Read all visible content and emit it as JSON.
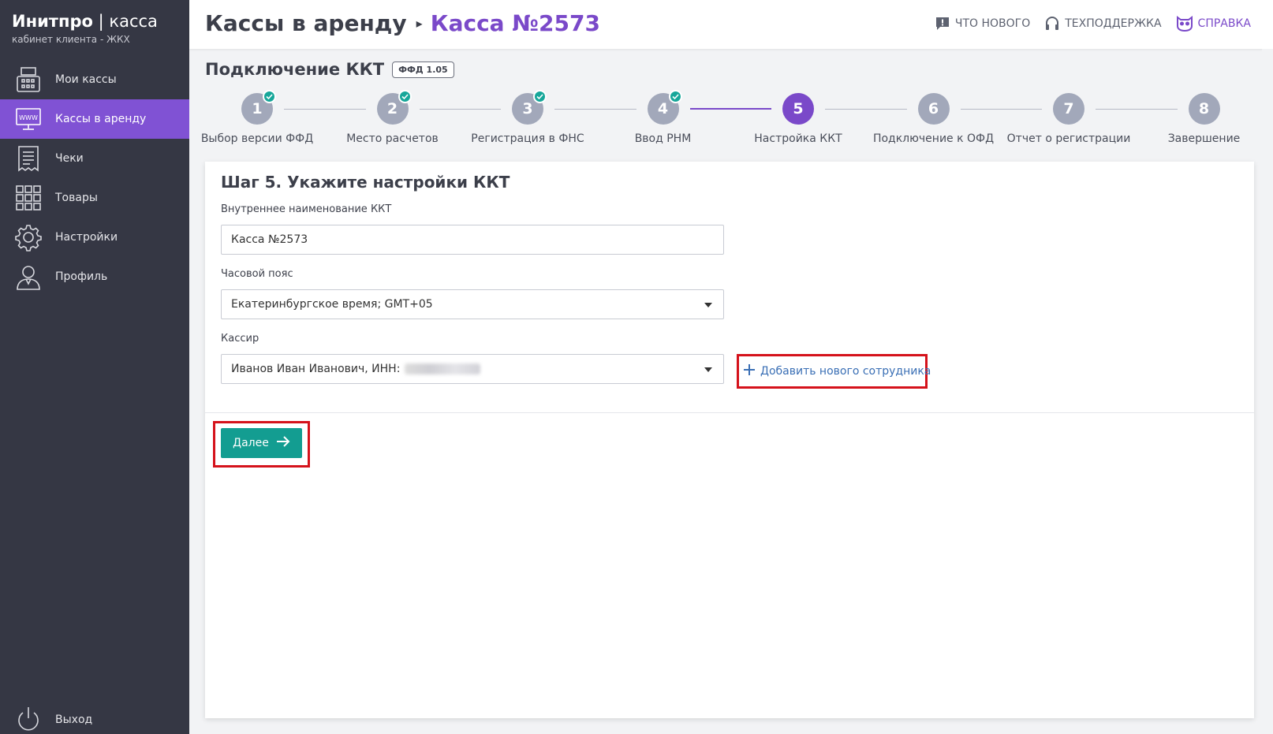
{
  "brand": {
    "name_bold": "Инитпро",
    "name_sep": "|",
    "name_light": "касса",
    "subtitle": "кабинет клиента - ЖКХ"
  },
  "sidebar": {
    "items": [
      {
        "label": "Мои кассы",
        "icon": "cash-register-icon",
        "active": false
      },
      {
        "label": "Кассы в аренду",
        "icon": "www-monitor-icon",
        "active": true
      },
      {
        "label": "Чеки",
        "icon": "receipt-icon",
        "active": false
      },
      {
        "label": "Товары",
        "icon": "grid-icon",
        "active": false
      },
      {
        "label": "Настройки",
        "icon": "gear-icon",
        "active": false
      },
      {
        "label": "Профиль",
        "icon": "user-icon",
        "active": false
      }
    ],
    "logout": {
      "label": "Выход",
      "icon": "power-icon"
    }
  },
  "header": {
    "breadcrumb_root": "Кассы в аренду",
    "breadcrumb_current": "Касса №2573",
    "links": {
      "news": "Что нового",
      "support": "Техподдержка",
      "help": "Справка"
    }
  },
  "section": {
    "title": "Подключение ККТ",
    "badge": "ФФД 1.05"
  },
  "stepper": {
    "current": 5,
    "steps": [
      {
        "num": "1",
        "label": "Выбор версии ФФД",
        "done": true
      },
      {
        "num": "2",
        "label": "Место расчетов",
        "done": true
      },
      {
        "num": "3",
        "label": "Регистрация в ФНС",
        "done": true
      },
      {
        "num": "4",
        "label": "Ввод РНМ",
        "done": true
      },
      {
        "num": "5",
        "label": "Настройка ККТ",
        "done": false
      },
      {
        "num": "6",
        "label": "Подключение к ОФД",
        "done": false
      },
      {
        "num": "7",
        "label": "Отчет о регистрации",
        "done": false
      },
      {
        "num": "8",
        "label": "Завершение",
        "done": false
      }
    ]
  },
  "form": {
    "title": "Шаг 5. Укажите настройки ККТ",
    "internal_name": {
      "label": "Внутреннее наименование ККТ",
      "value": "Касса №2573"
    },
    "timezone": {
      "label": "Часовой пояс",
      "value": "Екатеринбургское время; GMT+05"
    },
    "cashier": {
      "label": "Кассир",
      "value": "Иванов Иван Иванович, ИНН:"
    },
    "add_employee": "Добавить нового сотрудника",
    "next_button": "Далее"
  },
  "colors": {
    "sidebar": "#353744",
    "accent": "#7a49c9",
    "button": "#139d91",
    "check": "#17a79a",
    "highlight": "#d5121b"
  }
}
